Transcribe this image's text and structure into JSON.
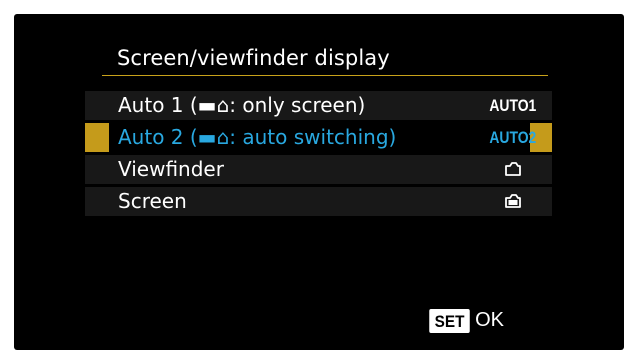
{
  "screen": {
    "title": "Screen/viewfinder display",
    "items": [
      {
        "label": "Auto 1 (▬⌂: only screen)",
        "value": "AUTO1",
        "icon": "",
        "selected": false
      },
      {
        "label": "Auto 2 (▬⌂: auto switching)",
        "value": "AUTO2",
        "icon": "",
        "selected": true
      },
      {
        "label": "Viewfinder",
        "value": "",
        "icon": "viewfinder-icon",
        "selected": false
      },
      {
        "label": "Screen",
        "value": "",
        "icon": "screen-icon",
        "selected": false
      }
    ],
    "set_badge": "SET",
    "ok_label": "OK"
  },
  "colors": {
    "accent": "#c59b1b",
    "selected_text": "#29a8e0",
    "row_bg": "#181818"
  }
}
